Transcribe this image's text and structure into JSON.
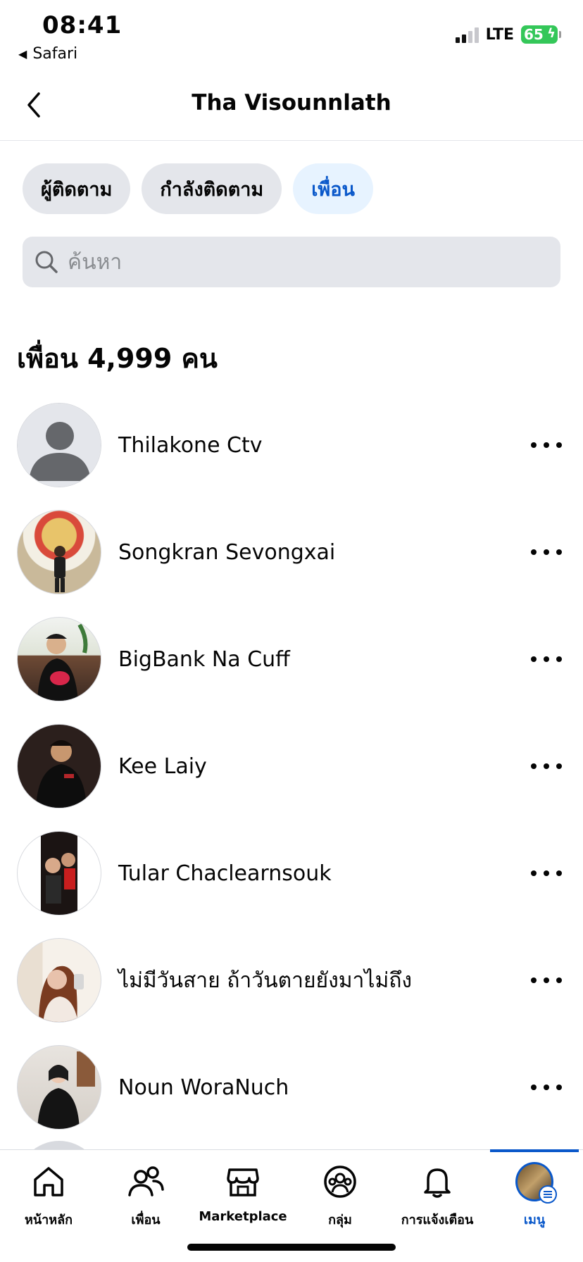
{
  "status_bar": {
    "time": "08:41",
    "back_app": "Safari",
    "network": "LTE",
    "battery": "65",
    "battery_color": "#34c759"
  },
  "header": {
    "title": "Tha Visounnlath",
    "back_icon": "chevron-left-icon"
  },
  "tabs": [
    {
      "label": "ผู้ติดตาม",
      "active": false
    },
    {
      "label": "กำลังติดตาม",
      "active": false
    },
    {
      "label": "เพื่อน",
      "active": true
    }
  ],
  "search": {
    "placeholder": "ค้นหา",
    "icon": "search-icon"
  },
  "friend_count_label": "เพื่อน 4,999 คน",
  "friends": [
    {
      "name": "Thilakone Ctv",
      "avatar": "default-avatar"
    },
    {
      "name": "Songkran Sevongxai",
      "avatar": "photo"
    },
    {
      "name": "BigBank Na Cuff",
      "avatar": "photo"
    },
    {
      "name": "Kee Laiy",
      "avatar": "photo"
    },
    {
      "name": "Tular Chaclearnsouk",
      "avatar": "photo"
    },
    {
      "name": "ไม่มีวันสาย ถ้าวันตายยังมาไม่ถึง",
      "avatar": "photo"
    },
    {
      "name": "Noun WoraNuch",
      "avatar": "photo"
    }
  ],
  "bottom_nav": [
    {
      "label": "หน้าหลัก",
      "icon": "home-icon",
      "active": false
    },
    {
      "label": "เพื่อน",
      "icon": "friends-icon",
      "active": false
    },
    {
      "label": "Marketplace",
      "icon": "marketplace-icon",
      "active": false
    },
    {
      "label": "กลุ่ม",
      "icon": "groups-icon",
      "active": false
    },
    {
      "label": "การแจ้งเตือน",
      "icon": "bell-icon",
      "active": false
    },
    {
      "label": "เมนู",
      "icon": "menu-avatar-icon",
      "active": true
    }
  ],
  "colors": {
    "accent": "#0a58ca",
    "active_tab_bg": "#e7f3ff",
    "chip_bg": "#e4e6eb"
  }
}
